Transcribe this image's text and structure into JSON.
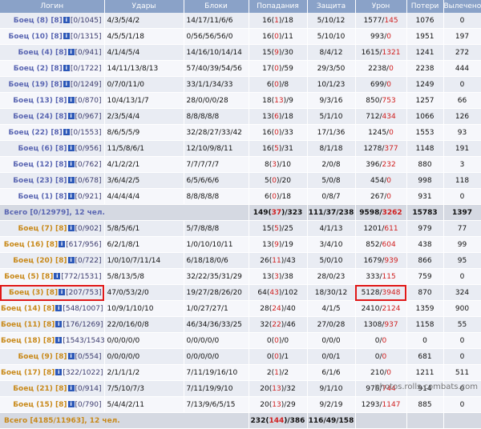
{
  "headers": [
    "Логин",
    "Удары",
    "Блоки",
    "Попадания",
    "Защита",
    "Урон",
    "Потери",
    "Вылечено"
  ],
  "team_blue": [
    {
      "name": "Боец (8)",
      "level": "[8]",
      "hp": "[0/1045]",
      "hits": "4/3/5/4/2",
      "blocks": "14/17/11/6/6",
      "p1": "16(",
      "p2": "1",
      "p3": ")/18",
      "defense": "5/10/12",
      "d1": "1577/",
      "d2": "145",
      "losses": "1076",
      "healed": "0"
    },
    {
      "name": "Боец (10)",
      "level": "[8]",
      "hp": "[0/1315]",
      "hits": "4/5/5/1/18",
      "blocks": "0/56/56/56/0",
      "p1": "16(",
      "p2": "0",
      "p3": ")/11",
      "defense": "5/10/10",
      "d1": "993/",
      "d2": "0",
      "losses": "1951",
      "healed": "197"
    },
    {
      "name": "Боец (4)",
      "level": "[8]",
      "hp": "[0/941]",
      "hits": "4/1/4/5/4",
      "blocks": "14/16/10/14/14",
      "p1": "15(",
      "p2": "9",
      "p3": ")/30",
      "defense": "8/4/12",
      "d1": "1615/",
      "d2": "1321",
      "losses": "1241",
      "healed": "272"
    },
    {
      "name": "Боец (2)",
      "level": "[8]",
      "hp": "[0/1722]",
      "hits": "14/11/13/8/13",
      "blocks": "57/40/39/54/56",
      "p1": "17(",
      "p2": "0",
      "p3": ")/59",
      "defense": "29/3/50",
      "d1": "2238/",
      "d2": "0",
      "losses": "2238",
      "healed": "444"
    },
    {
      "name": "Боец (19)",
      "level": "[8]",
      "hp": "[0/1249]",
      "hits": "0/7/0/11/0",
      "blocks": "33/1/1/34/33",
      "p1": "6(",
      "p2": "0",
      "p3": ")/8",
      "defense": "10/1/23",
      "d1": "699/",
      "d2": "0",
      "losses": "1249",
      "healed": "0"
    },
    {
      "name": "Боец (13)",
      "level": "[8]",
      "hp": "[0/870]",
      "hits": "10/4/13/1/7",
      "blocks": "28/0/0/0/28",
      "p1": "18(",
      "p2": "13",
      "p3": ")/9",
      "defense": "9/3/16",
      "d1": "850/",
      "d2": "753",
      "losses": "1257",
      "healed": "66"
    },
    {
      "name": "Боец (24)",
      "level": "[8]",
      "hp": "[0/967]",
      "hits": "2/3/5/4/4",
      "blocks": "8/8/8/8/8",
      "p1": "13(",
      "p2": "6",
      "p3": ")/18",
      "defense": "5/1/10",
      "d1": "712/",
      "d2": "434",
      "losses": "1066",
      "healed": "126"
    },
    {
      "name": "Боец (22)",
      "level": "[8]",
      "hp": "[0/1553]",
      "hits": "8/6/5/5/9",
      "blocks": "32/28/27/33/42",
      "p1": "16(",
      "p2": "0",
      "p3": ")/33",
      "defense": "17/1/36",
      "d1": "1245/",
      "d2": "0",
      "losses": "1553",
      "healed": "93"
    },
    {
      "name": "Боец (6)",
      "level": "[8]",
      "hp": "[0/956]",
      "hits": "11/5/8/6/1",
      "blocks": "12/10/9/8/11",
      "p1": "16(",
      "p2": "5",
      "p3": ")/31",
      "defense": "8/1/18",
      "d1": "1278/",
      "d2": "377",
      "losses": "1148",
      "healed": "191"
    },
    {
      "name": "Боец (12)",
      "level": "[8]",
      "hp": "[0/762]",
      "hits": "4/1/2/2/1",
      "blocks": "7/7/7/7/7",
      "p1": "8(",
      "p2": "3",
      "p3": ")/10",
      "defense": "2/0/8",
      "d1": "396/",
      "d2": "232",
      "losses": "880",
      "healed": "3"
    },
    {
      "name": "Боец (23)",
      "level": "[8]",
      "hp": "[0/678]",
      "hits": "3/6/4/2/5",
      "blocks": "6/5/6/6/6",
      "p1": "5(",
      "p2": "0",
      "p3": ")/20",
      "defense": "5/0/8",
      "d1": "454/",
      "d2": "0",
      "losses": "998",
      "healed": "118"
    },
    {
      "name": "Боец (1)",
      "level": "[8]",
      "hp": "[0/921]",
      "hits": "4/4/4/4/4",
      "blocks": "8/8/8/8/8",
      "p1": "6(",
      "p2": "0",
      "p3": ")/18",
      "defense": "0/8/7",
      "d1": "267/",
      "d2": "0",
      "losses": "931",
      "healed": "0"
    }
  ],
  "total_blue": {
    "label": "Всего [0/12979], 12 чел.",
    "p1": "149(",
    "p2": "37",
    "p3": ")/323",
    "defense": "111/37/238",
    "d1": "9598/",
    "d2": "3262",
    "losses": "15783",
    "healed": "1397"
  },
  "team_orange": [
    {
      "name": "Боец (7)",
      "level": "[8]",
      "hp": "[0/902]",
      "hits": "5/8/5/6/1",
      "blocks": "5/7/8/8/8",
      "p1": "15(",
      "p2": "5",
      "p3": ")/25",
      "defense": "4/1/13",
      "d1": "1201/",
      "d2": "611",
      "losses": "979",
      "healed": "77"
    },
    {
      "name": "Боец (16)",
      "level": "[8]",
      "hp": "[617/956]",
      "hits": "6/2/1/8/1",
      "blocks": "1/0/10/10/11",
      "p1": "13(",
      "p2": "9",
      "p3": ")/19",
      "defense": "3/4/10",
      "d1": "852/",
      "d2": "604",
      "losses": "438",
      "healed": "99"
    },
    {
      "name": "Боец (20)",
      "level": "[8]",
      "hp": "[0/722]",
      "hits": "1/0/10/7/11/14",
      "blocks": "6/18/18/0/6",
      "p1": "26(",
      "p2": "11",
      "p3": ")/43",
      "defense": "5/0/10",
      "d1": "1679/",
      "d2": "939",
      "losses": "866",
      "healed": "95"
    },
    {
      "name": "Боец (5)",
      "level": "[8]",
      "hp": "[772/1531]",
      "hits": "5/8/13/5/8",
      "blocks": "32/22/35/31/29",
      "p1": "13(",
      "p2": "3",
      "p3": ")/38",
      "defense": "28/0/23",
      "d1": "333/",
      "d2": "115",
      "losses": "759",
      "healed": "0"
    },
    {
      "name": "Боец (3)",
      "level": "[8]",
      "hp": "[207/753]",
      "hits": "47/0/53/2/0",
      "blocks": "19/27/28/26/20",
      "p1": "64(",
      "p2": "43",
      "p3": ")/102",
      "defense": "18/30/12",
      "d1": "5128/",
      "d2": "3948",
      "losses": "870",
      "healed": "324"
    },
    {
      "name": "Боец (14)",
      "level": "[8]",
      "hp": "[548/1007]",
      "hits": "10/9/1/10/10",
      "blocks": "1/0/27/27/1",
      "p1": "28(",
      "p2": "24",
      "p3": ")/40",
      "defense": "4/1/5",
      "d1": "2410/",
      "d2": "2124",
      "losses": "1359",
      "healed": "900"
    },
    {
      "name": "Боец (11)",
      "level": "[8]",
      "hp": "[176/1269]",
      "hits": "22/0/16/0/8",
      "blocks": "46/34/36/33/25",
      "p1": "32(",
      "p2": "22",
      "p3": ")/46",
      "defense": "27/0/28",
      "d1": "1308/",
      "d2": "937",
      "losses": "1158",
      "healed": "55"
    },
    {
      "name": "Боец (18)",
      "level": "[8]",
      "hp": "[1543/1543]",
      "hits": "0/0/0/0/0",
      "blocks": "0/0/0/0/0",
      "p1": "0(",
      "p2": "0",
      "p3": ")/0",
      "defense": "0/0/0",
      "d1": "0/",
      "d2": "0",
      "losses": "0",
      "healed": "0"
    },
    {
      "name": "Боец (9)",
      "level": "[8]",
      "hp": "[0/554]",
      "hits": "0/0/0/0/0",
      "blocks": "0/0/0/0/0",
      "p1": "0(",
      "p2": "0",
      "p3": ")/1",
      "defense": "0/0/1",
      "d1": "0/",
      "d2": "0",
      "losses": "681",
      "healed": "0"
    },
    {
      "name": "Боец (17)",
      "level": "[8]",
      "hp": "[322/1022]",
      "hits": "2/1/1/1/2",
      "blocks": "7/11/19/16/10",
      "p1": "2(",
      "p2": "1",
      "p3": ")/2",
      "defense": "6/1/6",
      "d1": "210/",
      "d2": "0",
      "losses": "1211",
      "healed": "511"
    },
    {
      "name": "Боец (21)",
      "level": "[8]",
      "hp": "[0/914]",
      "hits": "7/5/10/7/3",
      "blocks": "7/11/19/9/10",
      "p1": "20(",
      "p2": "13",
      "p3": ")/32",
      "defense": "9/1/10",
      "d1": "976/",
      "d2": "744",
      "losses": "914",
      "healed": "0"
    },
    {
      "name": "Боец (15)",
      "level": "[8]",
      "hp": "[0/790]",
      "hits": "5/4/4/2/11",
      "blocks": "7/13/9/6/5/15",
      "p1": "20(",
      "p2": "13",
      "p3": ")/29",
      "defense": "9/2/19",
      "d1": "1293/",
      "d2": "1147",
      "losses": "885",
      "healed": "0"
    }
  ],
  "total_orange": {
    "label": "Всего [4185/11963], 12 чел.",
    "p1": "232(",
    "p2": "144",
    "p3": ")/386",
    "defense": "116/49/158",
    "d1": "",
    "d2": "",
    "losses": "",
    "healed": ""
  },
  "watermark": "photos.rolls.combats.com",
  "colors": {
    "header": "#8aa2c8",
    "blue_name": "#5a66b2",
    "orange_name": "#c8891a",
    "highlight": "#e01818"
  }
}
